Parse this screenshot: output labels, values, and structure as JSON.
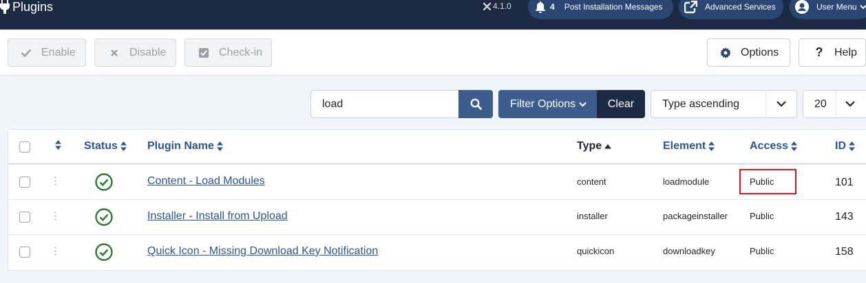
{
  "header": {
    "title": "Plugins",
    "version": "4.1.0",
    "post_install": {
      "count": "4",
      "label": "Post Installation Messages"
    },
    "advanced_services": "Advanced Services",
    "user_menu": "User Menu"
  },
  "toolbar": {
    "enable": "Enable",
    "disable": "Disable",
    "checkin": "Check-in",
    "options": "Options",
    "help": "Help"
  },
  "filters": {
    "search_value": "load",
    "filter_options": "Filter Options",
    "clear": "Clear",
    "sort": "Type ascending",
    "limit": "20"
  },
  "table": {
    "columns": {
      "status": "Status",
      "plugin_name": "Plugin Name",
      "type": "Type",
      "element": "Element",
      "access": "Access",
      "id": "ID"
    },
    "rows": [
      {
        "name": "Content - Load Modules",
        "type": "content",
        "element": "loadmodule",
        "access": "Public",
        "id": "101"
      },
      {
        "name": "Installer - Install from Upload",
        "type": "installer",
        "element": "packageinstaller",
        "access": "Public",
        "id": "143"
      },
      {
        "name": "Quick Icon - Missing Download Key Notification",
        "type": "quickicon",
        "element": "downloadkey",
        "access": "Public",
        "id": "158"
      }
    ]
  },
  "colors": {
    "header_bg": "#1c2a44",
    "primary": "#3b5d8e",
    "link": "#2a5591",
    "success": "#2e7d32",
    "highlight": "#e0101c"
  }
}
